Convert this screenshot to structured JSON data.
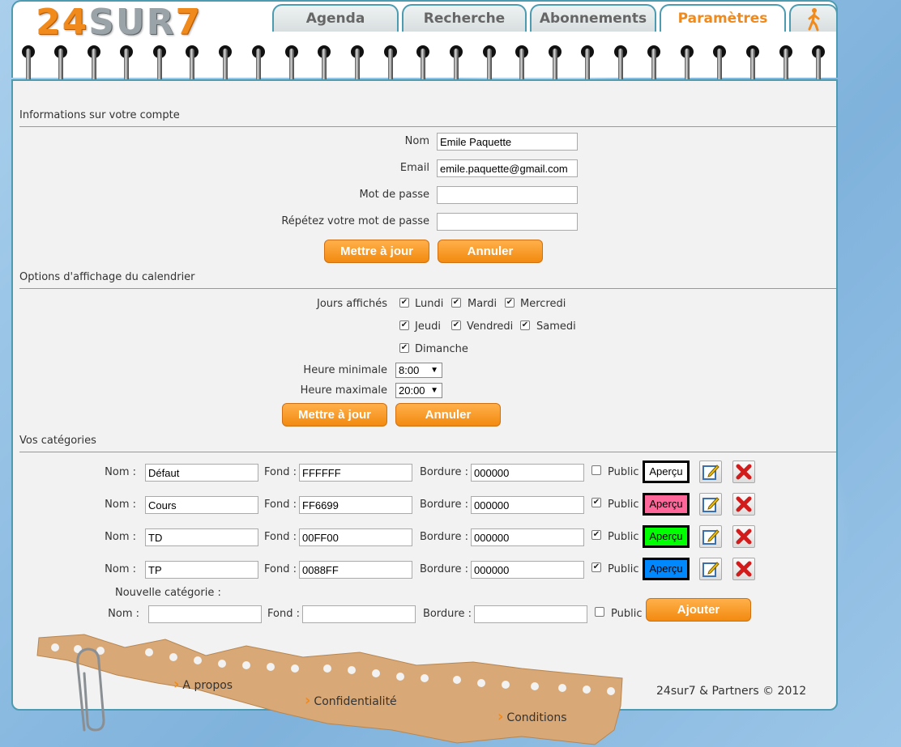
{
  "header": {
    "logo_text": "24SUR7",
    "tabs": [
      {
        "label": "Agenda"
      },
      {
        "label": "Recherche"
      },
      {
        "label": "Abonnements"
      },
      {
        "label": "Paramètres",
        "active": true
      }
    ],
    "exit_icon": "walking-person-icon"
  },
  "account": {
    "title": "Informations sur votre compte",
    "name_label": "Nom",
    "name_value": "Emile Paquette",
    "email_label": "Email",
    "email_value": "emile.paquette@gmail.com",
    "password_label": "Mot de passe",
    "password_value": "",
    "repeat_label": "Répétez votre mot de passe",
    "repeat_value": "",
    "update_label": "Mettre à jour",
    "cancel_label": "Annuler"
  },
  "calendar": {
    "title": "Options d'affichage du calendrier",
    "days_label": "Jours affichés",
    "days": [
      {
        "label": "Lundi",
        "checked": true
      },
      {
        "label": "Mardi",
        "checked": true
      },
      {
        "label": "Mercredi",
        "checked": true
      },
      {
        "label": "Jeudi",
        "checked": true
      },
      {
        "label": "Vendredi",
        "checked": true
      },
      {
        "label": "Samedi",
        "checked": true
      },
      {
        "label": "Dimanche",
        "checked": true
      }
    ],
    "min_hour_label": "Heure minimale",
    "min_hour_value": "8:00",
    "max_hour_label": "Heure maximale",
    "max_hour_value": "20:00",
    "update_label": "Mettre à jour",
    "cancel_label": "Annuler"
  },
  "categories": {
    "title": "Vos catégories",
    "name_label": "Nom :",
    "bg_label": "Fond :",
    "border_label": "Bordure :",
    "public_label": "Public",
    "preview_label": "Aperçu",
    "items": [
      {
        "name": "Défaut",
        "bg": "FFFFFF",
        "border": "000000",
        "public": false,
        "color": "#FFFFFF"
      },
      {
        "name": "Cours",
        "bg": "FF6699",
        "border": "000000",
        "public": true,
        "color": "#FF6699"
      },
      {
        "name": "TD",
        "bg": "00FF00",
        "border": "000000",
        "public": true,
        "color": "#00FF00"
      },
      {
        "name": "TP",
        "bg": "0088FF",
        "border": "000000",
        "public": true,
        "color": "#0088FF"
      }
    ],
    "new_title": "Nouvelle catégorie :",
    "add_label": "Ajouter"
  },
  "footer": {
    "links": [
      "A propos",
      "Confidentialité",
      "Conditions"
    ],
    "copyright": "24sur7 & Partners © 2012"
  },
  "colors": {
    "accent": "#f08a1c",
    "frame": "#4c9bb0"
  }
}
